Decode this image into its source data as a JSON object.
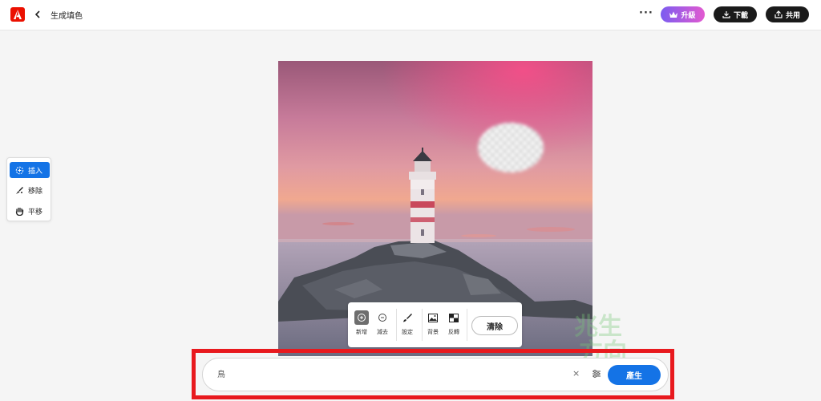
{
  "header": {
    "title": "生成填色",
    "more_label": "···",
    "upgrade_label": "升級",
    "download_label": "下載",
    "share_label": "共用"
  },
  "tools": {
    "items": [
      {
        "label": "插入",
        "icon": "insert-brush-icon",
        "active": true
      },
      {
        "label": "移除",
        "icon": "remove-brush-icon",
        "active": false
      },
      {
        "label": "平移",
        "icon": "hand-pan-icon",
        "active": false
      }
    ]
  },
  "mask_tools": {
    "add_label": "新增",
    "subtract_label": "減去",
    "settings_label": "設定",
    "background_label": "背景",
    "invert_label": "反轉",
    "clear_label": "清除"
  },
  "prompt": {
    "value": "鳥",
    "clear_label": "×",
    "generate_label": "產生"
  },
  "watermark": {
    "line1": "兆生",
    "line2": "方向"
  },
  "colors": {
    "accent": "#1473e6",
    "frame": "#e8191e",
    "brand": "#eb1000"
  }
}
